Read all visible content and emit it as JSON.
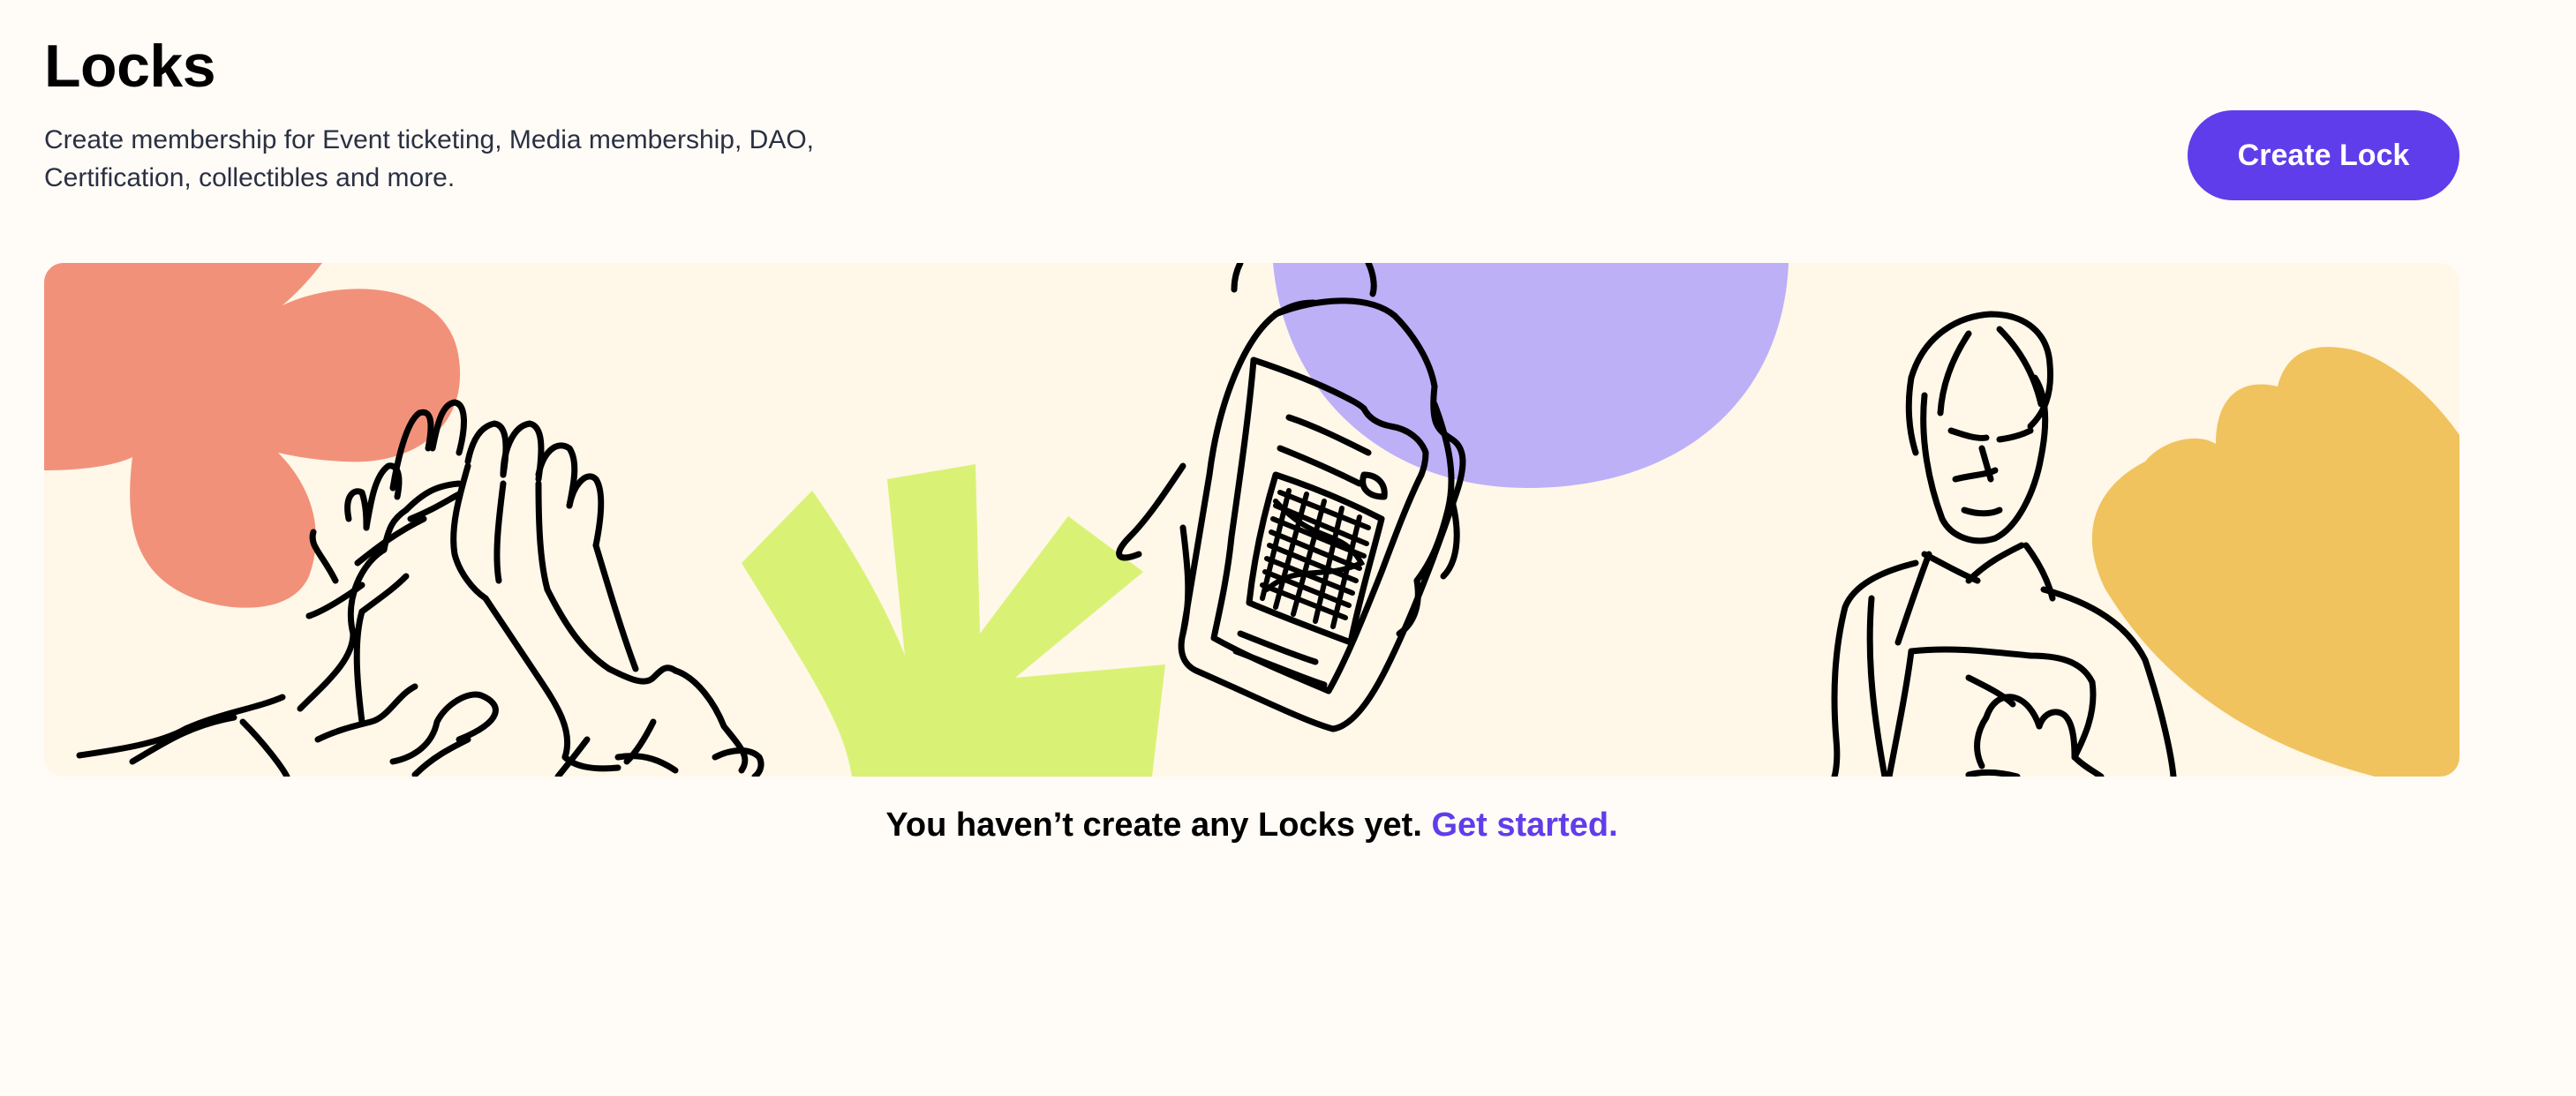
{
  "header": {
    "title": "Locks",
    "description": "Create membership for Event ticketing, Media membership, DAO, Certification, collectibles and more."
  },
  "actions": {
    "create_lock_label": "Create Lock"
  },
  "empty_state": {
    "message": "You haven’t create any Locks yet.",
    "link_label": "Get started."
  },
  "illustration": {
    "icons": [
      "flower-icon",
      "high-five-hands-icon",
      "starburst-icon",
      "phone-with-ticket-icon",
      "person-with-phone-icon",
      "cloud-shape-icon"
    ],
    "colors": {
      "background": "#FFF7E8",
      "salmon": "#F2917A",
      "lime": "#D9F276",
      "lavender": "#BDB0F7",
      "mustard": "#F0C35E",
      "ink": "#000000"
    }
  },
  "colors": {
    "page_background": "#FFFCF7",
    "accent": "#603DEB",
    "description_text": "#2A3042"
  }
}
